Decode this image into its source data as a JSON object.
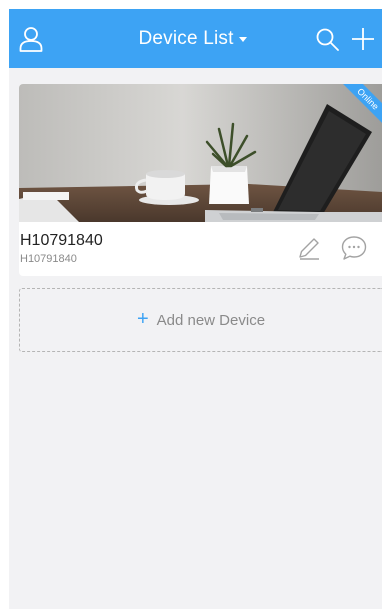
{
  "header": {
    "title": "Device List",
    "icons": {
      "left": "user-icon",
      "search": "search-icon",
      "add": "plus-icon"
    }
  },
  "device": {
    "name": "H10791840",
    "id": "H10791840",
    "status": "Online",
    "icons": {
      "edit": "pencil-icon",
      "message": "chat-bubble-icon"
    }
  },
  "add_device": {
    "plus": "+",
    "label": "Add new Device"
  },
  "colors": {
    "accent": "#3da3f4",
    "background": "#f2f2f4",
    "muted_text": "#8a8a8a"
  }
}
